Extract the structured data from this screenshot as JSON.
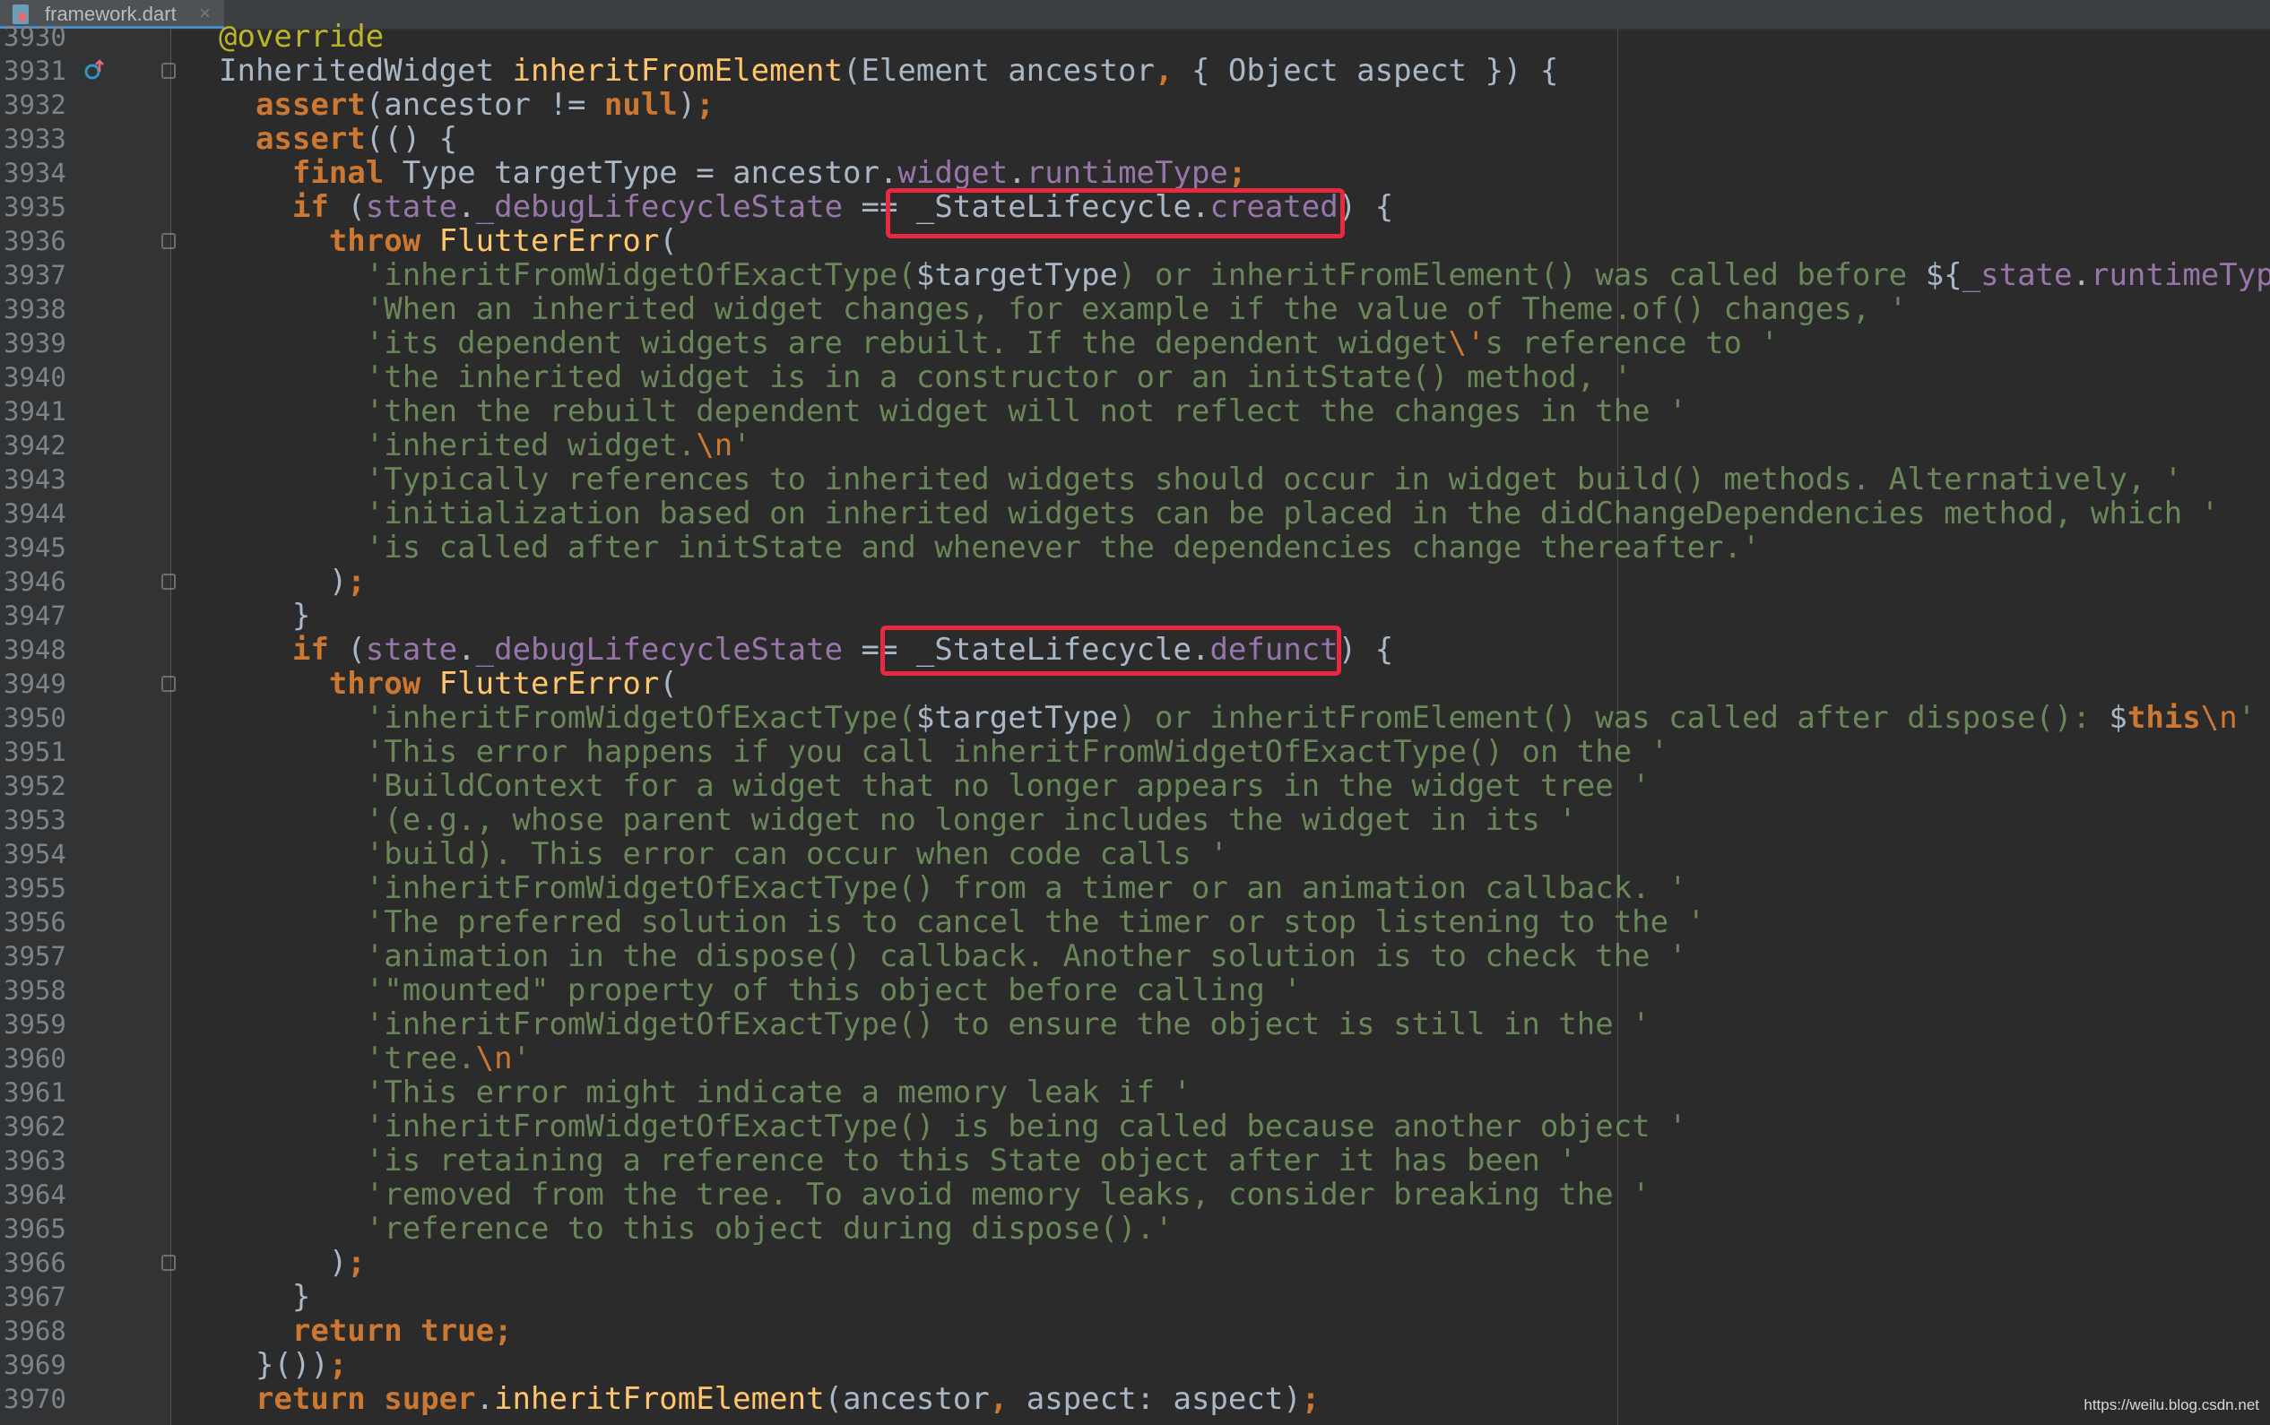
{
  "tab": {
    "label": "framework.dart",
    "close": "×"
  },
  "watermark": "https://weilu.blog.csdn.net",
  "colors": {
    "background": "#2b2b2b",
    "keyword": "#cc7832",
    "function": "#ffc66d",
    "property": "#9876aa",
    "string": "#6a8759",
    "highlight_box": "#e8293f"
  },
  "lines": [
    {
      "n": "3930",
      "tokens": [
        [
          "ann",
          "@override"
        ]
      ]
    },
    {
      "n": "3931",
      "tokens": [
        [
          "",
          "InheritedWidget "
        ],
        [
          "fn",
          "inheritFromElement"
        ],
        [
          "",
          "(Element ancestor"
        ],
        [
          "kw",
          ","
        ],
        [
          "",
          " { Object aspect }) {"
        ]
      ]
    },
    {
      "n": "3932",
      "tokens": [
        [
          "",
          "  "
        ],
        [
          "kw",
          "assert"
        ],
        [
          "",
          "(ancestor != "
        ],
        [
          "kw",
          "null"
        ],
        [
          "",
          ")"
        ],
        [
          "kw",
          ";"
        ]
      ]
    },
    {
      "n": "3933",
      "tokens": [
        [
          "",
          "  "
        ],
        [
          "kw",
          "assert"
        ],
        [
          "",
          "(() {"
        ]
      ]
    },
    {
      "n": "3934",
      "tokens": [
        [
          "",
          "    "
        ],
        [
          "kw",
          "final "
        ],
        [
          "",
          "Type targetType = ancestor."
        ],
        [
          "prop",
          "widget"
        ],
        [
          "",
          "."
        ],
        [
          "prop",
          "runtimeType"
        ],
        [
          "kw",
          ";"
        ]
      ]
    },
    {
      "n": "3935",
      "tokens": [
        [
          "",
          "    "
        ],
        [
          "kw",
          "if "
        ],
        [
          "",
          "("
        ],
        [
          "prop",
          "state"
        ],
        [
          "",
          "."
        ],
        [
          "prop",
          "_debugLifecycleState"
        ],
        [
          "",
          " == _StateLifecycle."
        ],
        [
          "prop",
          "created"
        ],
        [
          "",
          ") {"
        ]
      ]
    },
    {
      "n": "3936",
      "tokens": [
        [
          "",
          "      "
        ],
        [
          "kw",
          "throw "
        ],
        [
          "fn",
          "FlutterError"
        ],
        [
          "",
          "("
        ]
      ]
    },
    {
      "n": "3937",
      "tokens": [
        [
          "",
          "        "
        ],
        [
          "str",
          "'inheritFromWidgetOfExactType("
        ],
        [
          "",
          "$targetType"
        ],
        [
          "str",
          ") or inheritFromElement() was called before "
        ],
        [
          "",
          "${"
        ],
        [
          "prop",
          "_state"
        ],
        [
          "",
          "."
        ],
        [
          "prop",
          "runtimeType"
        ],
        [
          "",
          "}."
        ]
      ]
    },
    {
      "n": "3938",
      "tokens": [
        [
          "",
          "        "
        ],
        [
          "str",
          "'When an inherited widget changes, for example if the value of Theme.of() changes, '"
        ]
      ]
    },
    {
      "n": "3939",
      "tokens": [
        [
          "",
          "        "
        ],
        [
          "str",
          "'its dependent widgets are rebuilt. If the dependent widget"
        ],
        [
          "esc",
          "\\'"
        ],
        [
          "str",
          "s reference to '"
        ]
      ]
    },
    {
      "n": "3940",
      "tokens": [
        [
          "",
          "        "
        ],
        [
          "str",
          "'the inherited widget is in a constructor or an initState() method, '"
        ]
      ]
    },
    {
      "n": "3941",
      "tokens": [
        [
          "",
          "        "
        ],
        [
          "str",
          "'then the rebuilt dependent widget will not reflect the changes in the '"
        ]
      ]
    },
    {
      "n": "3942",
      "tokens": [
        [
          "",
          "        "
        ],
        [
          "str",
          "'inherited widget."
        ],
        [
          "esc",
          "\\n"
        ],
        [
          "str",
          "'"
        ]
      ]
    },
    {
      "n": "3943",
      "tokens": [
        [
          "",
          "        "
        ],
        [
          "str",
          "'Typically references to inherited widgets should occur in widget build() methods. Alternatively, '"
        ]
      ]
    },
    {
      "n": "3944",
      "tokens": [
        [
          "",
          "        "
        ],
        [
          "str",
          "'initialization based on inherited widgets can be placed in the didChangeDependencies method, which '"
        ]
      ]
    },
    {
      "n": "3945",
      "tokens": [
        [
          "",
          "        "
        ],
        [
          "str",
          "'is called after initState and whenever the dependencies change thereafter.'"
        ]
      ]
    },
    {
      "n": "3946",
      "tokens": [
        [
          "",
          "      )"
        ],
        [
          "kw",
          ";"
        ]
      ]
    },
    {
      "n": "3947",
      "tokens": [
        [
          "",
          "    }"
        ]
      ]
    },
    {
      "n": "3948",
      "tokens": [
        [
          "",
          "    "
        ],
        [
          "kw",
          "if "
        ],
        [
          "",
          "("
        ],
        [
          "prop",
          "state"
        ],
        [
          "",
          "."
        ],
        [
          "prop",
          "_debugLifecycleState"
        ],
        [
          "",
          " == _StateLifecycle."
        ],
        [
          "prop",
          "defunct"
        ],
        [
          "",
          ") {"
        ]
      ]
    },
    {
      "n": "3949",
      "tokens": [
        [
          "",
          "      "
        ],
        [
          "kw",
          "throw "
        ],
        [
          "fn",
          "FlutterError"
        ],
        [
          "",
          "("
        ]
      ]
    },
    {
      "n": "3950",
      "tokens": [
        [
          "",
          "        "
        ],
        [
          "str",
          "'inheritFromWidgetOfExactType("
        ],
        [
          "",
          "$targetType"
        ],
        [
          "str",
          ") or inheritFromElement() was called after dispose(): "
        ],
        [
          "",
          "$"
        ],
        [
          "kw",
          "this"
        ],
        [
          "esc",
          "\\n"
        ],
        [
          "str",
          "'"
        ]
      ]
    },
    {
      "n": "3951",
      "tokens": [
        [
          "",
          "        "
        ],
        [
          "str",
          "'This error happens if you call inheritFromWidgetOfExactType() on the '"
        ]
      ]
    },
    {
      "n": "3952",
      "tokens": [
        [
          "",
          "        "
        ],
        [
          "str",
          "'BuildContext for a widget that no longer appears in the widget tree '"
        ]
      ]
    },
    {
      "n": "3953",
      "tokens": [
        [
          "",
          "        "
        ],
        [
          "str",
          "'(e.g., whose parent widget no longer includes the widget in its '"
        ]
      ]
    },
    {
      "n": "3954",
      "tokens": [
        [
          "",
          "        "
        ],
        [
          "str",
          "'build). This error can occur when code calls '"
        ]
      ]
    },
    {
      "n": "3955",
      "tokens": [
        [
          "",
          "        "
        ],
        [
          "str",
          "'inheritFromWidgetOfExactType() from a timer or an animation callback. '"
        ]
      ]
    },
    {
      "n": "3956",
      "tokens": [
        [
          "",
          "        "
        ],
        [
          "str",
          "'The preferred solution is to cancel the timer or stop listening to the '"
        ]
      ]
    },
    {
      "n": "3957",
      "tokens": [
        [
          "",
          "        "
        ],
        [
          "str",
          "'animation in the dispose() callback. Another solution is to check the '"
        ]
      ]
    },
    {
      "n": "3958",
      "tokens": [
        [
          "",
          "        "
        ],
        [
          "str",
          "'\"mounted\" property of this object before calling '"
        ]
      ]
    },
    {
      "n": "3959",
      "tokens": [
        [
          "",
          "        "
        ],
        [
          "str",
          "'inheritFromWidgetOfExactType() to ensure the object is still in the '"
        ]
      ]
    },
    {
      "n": "3960",
      "tokens": [
        [
          "",
          "        "
        ],
        [
          "str",
          "'tree."
        ],
        [
          "esc",
          "\\n"
        ],
        [
          "str",
          "'"
        ]
      ]
    },
    {
      "n": "3961",
      "tokens": [
        [
          "",
          "        "
        ],
        [
          "str",
          "'This error might indicate a memory leak if '"
        ]
      ]
    },
    {
      "n": "3962",
      "tokens": [
        [
          "",
          "        "
        ],
        [
          "str",
          "'inheritFromWidgetOfExactType() is being called because another object '"
        ]
      ]
    },
    {
      "n": "3963",
      "tokens": [
        [
          "",
          "        "
        ],
        [
          "str",
          "'is retaining a reference to this State object after it has been '"
        ]
      ]
    },
    {
      "n": "3964",
      "tokens": [
        [
          "",
          "        "
        ],
        [
          "str",
          "'removed from the tree. To avoid memory leaks, consider breaking the '"
        ]
      ]
    },
    {
      "n": "3965",
      "tokens": [
        [
          "",
          "        "
        ],
        [
          "str",
          "'reference to this object during dispose().'"
        ]
      ]
    },
    {
      "n": "3966",
      "tokens": [
        [
          "",
          "      )"
        ],
        [
          "kw",
          ";"
        ]
      ]
    },
    {
      "n": "3967",
      "tokens": [
        [
          "",
          "    }"
        ]
      ]
    },
    {
      "n": "3968",
      "tokens": [
        [
          "",
          "    "
        ],
        [
          "kw",
          "return true;"
        ]
      ]
    },
    {
      "n": "3969",
      "tokens": [
        [
          "",
          "  }())"
        ],
        [
          "kw",
          ";"
        ]
      ]
    },
    {
      "n": "3970",
      "tokens": [
        [
          "",
          "  "
        ],
        [
          "kw",
          "return super"
        ],
        [
          "",
          "."
        ],
        [
          "fn",
          "inheritFromElement"
        ],
        [
          "",
          "(ancestor"
        ],
        [
          "kw",
          ","
        ],
        [
          "",
          " aspect: aspect)"
        ],
        [
          "kw",
          ";"
        ]
      ]
    }
  ]
}
